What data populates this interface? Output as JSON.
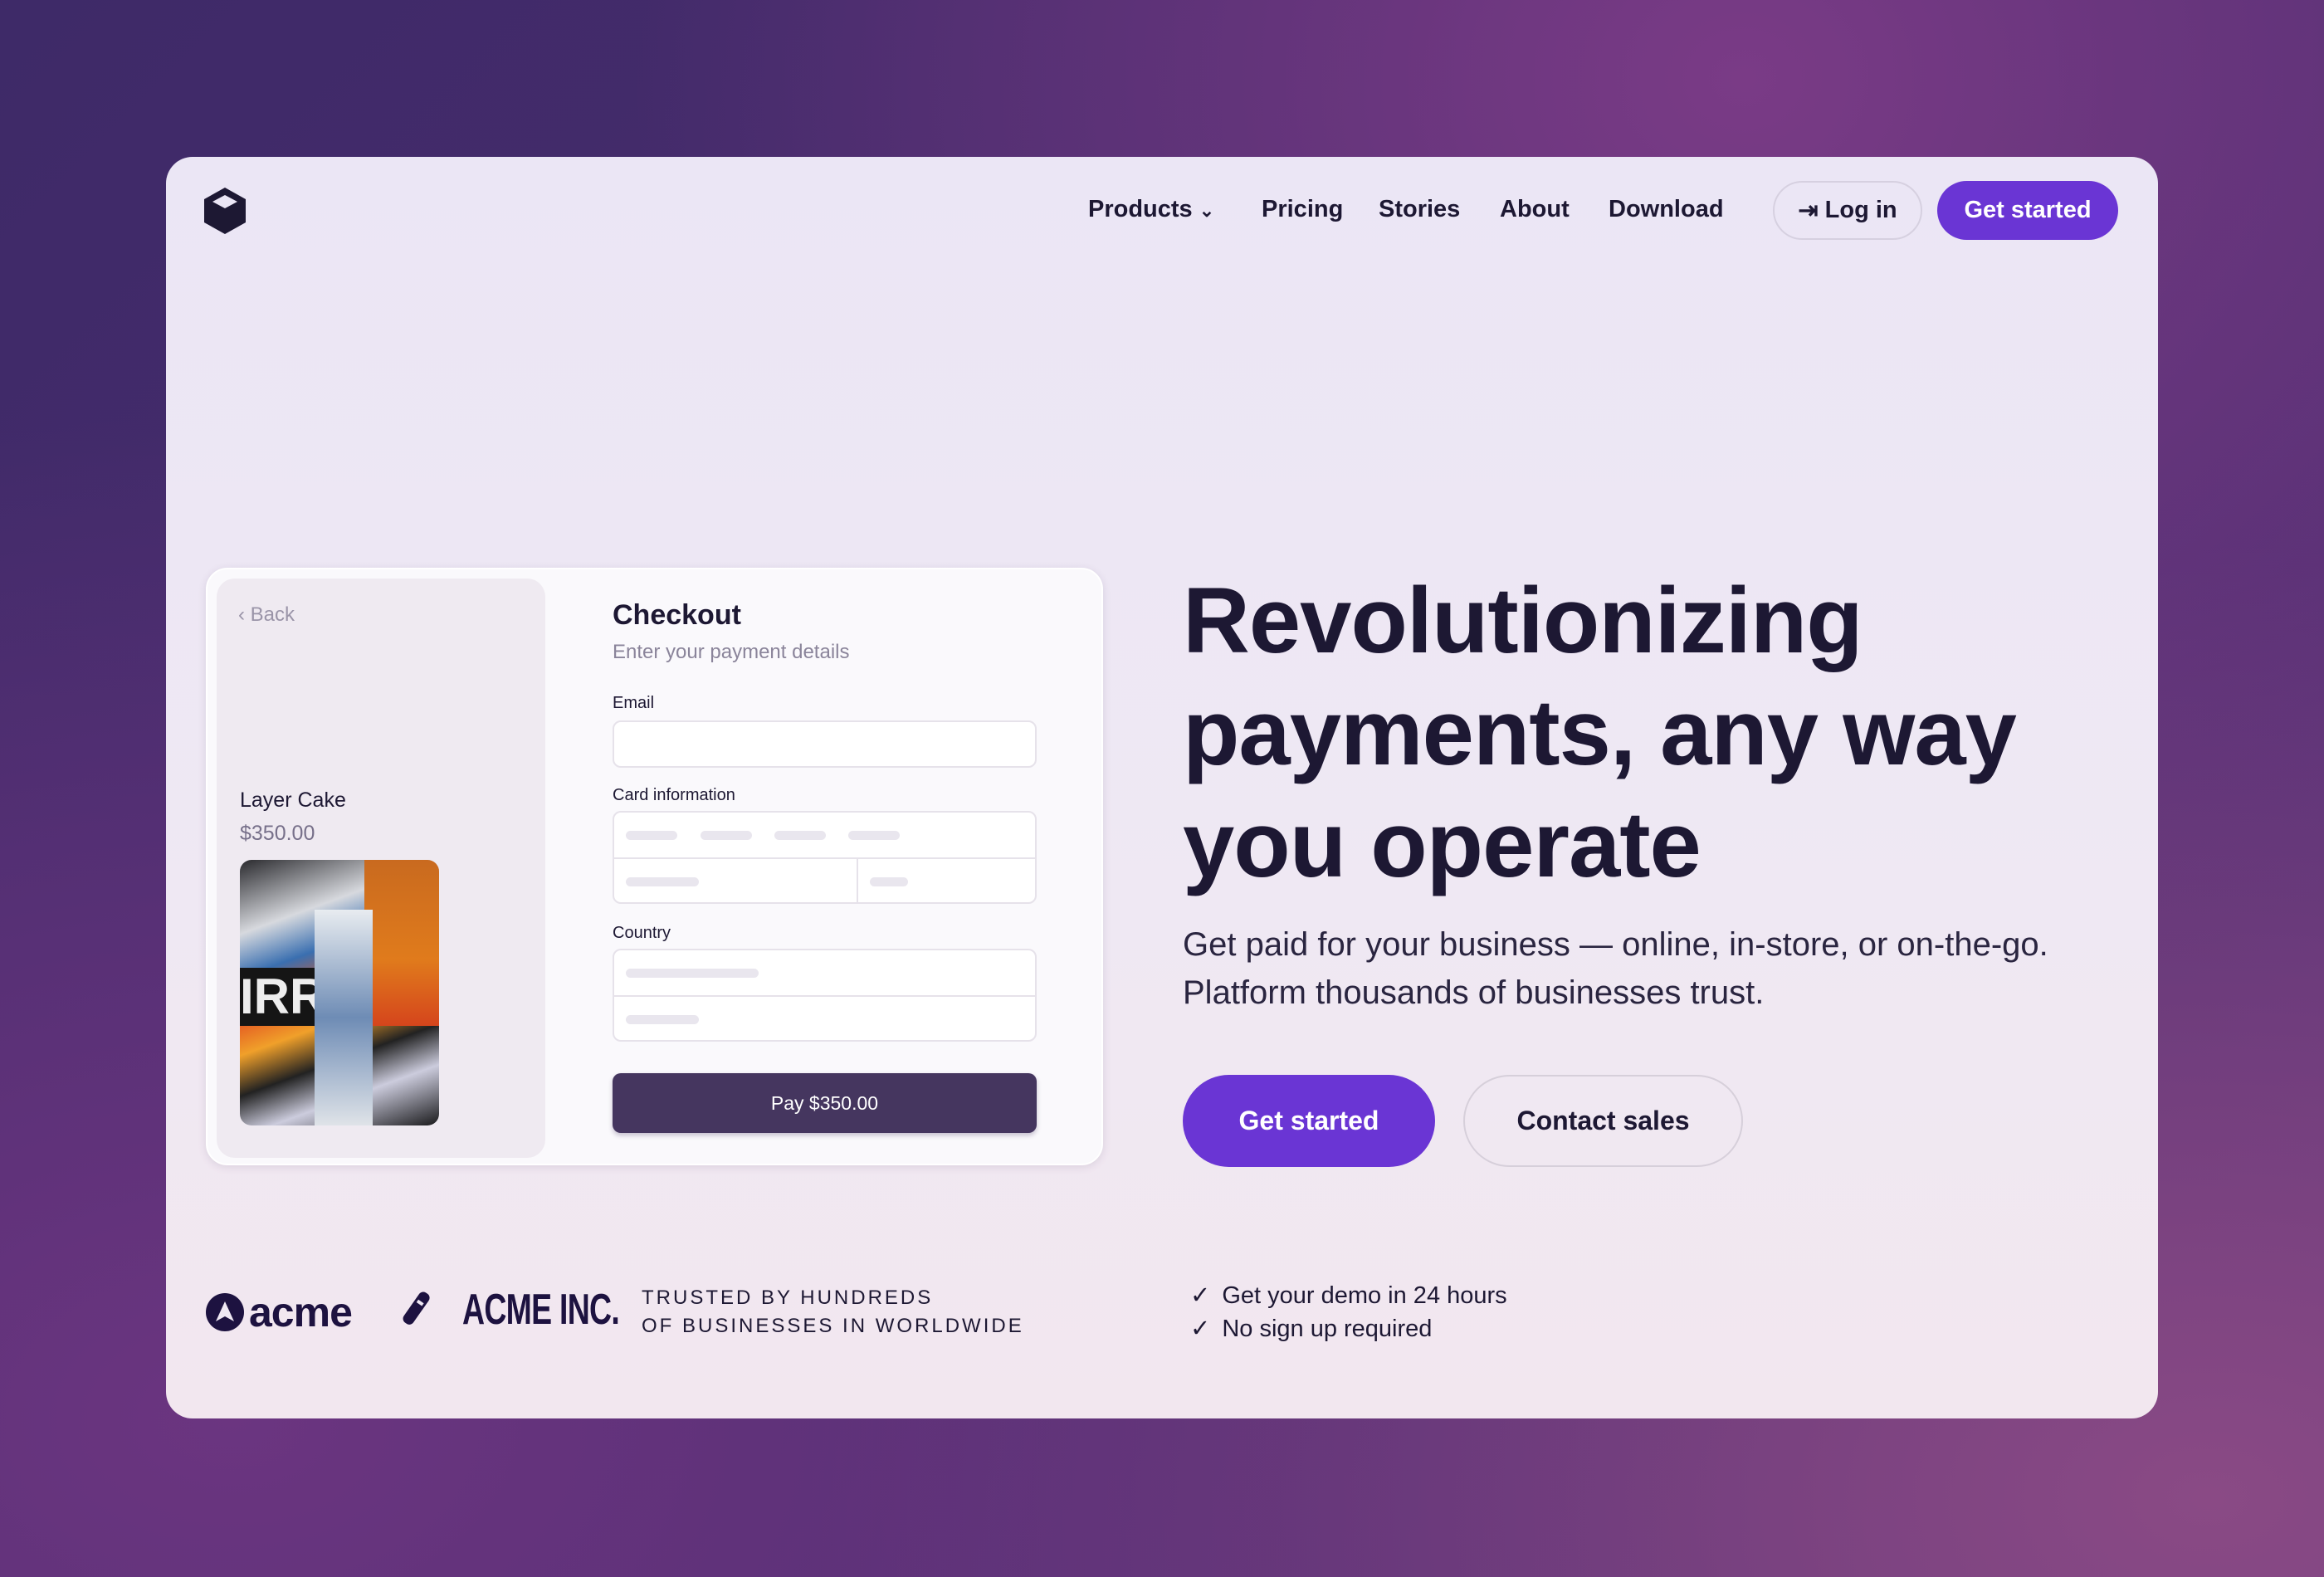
{
  "colors": {
    "accent": "#6a35d4",
    "pay_button": "#45365f",
    "text": "#1d1833"
  },
  "nav": {
    "logo": "cube-logo",
    "items": [
      {
        "label": "Products",
        "has_dropdown": true
      },
      {
        "label": "Pricing"
      },
      {
        "label": "Stories"
      },
      {
        "label": "About"
      },
      {
        "label": "Download"
      }
    ],
    "login_label": "Log in",
    "get_started_label": "Get started"
  },
  "checkout": {
    "back_label": "Back",
    "product_name": "Layer Cake",
    "product_price": "$350.00",
    "title": "Checkout",
    "subtitle": "Enter your payment details",
    "email_label": "Email",
    "card_label": "Card information",
    "country_label": "Country",
    "pay_label": "Pay $350.00"
  },
  "hero": {
    "headline_lines": [
      "Revolutionizing",
      "payments, any way",
      "you operate"
    ],
    "subtitle_lines": [
      "Get paid for your business — online, in-store, or on-the-go.",
      "Platform thousands of businesses trust."
    ],
    "primary_cta": "Get started",
    "secondary_cta": "Contact sales"
  },
  "footer": {
    "logos": [
      "acme",
      "ACME INC."
    ],
    "trusted_lines": [
      "TRUSTED BY HUNDREDS",
      "OF BUSINESSES IN WORLDWIDE"
    ],
    "checks": [
      "Get your demo in 24 hours",
      "No sign up required"
    ]
  }
}
